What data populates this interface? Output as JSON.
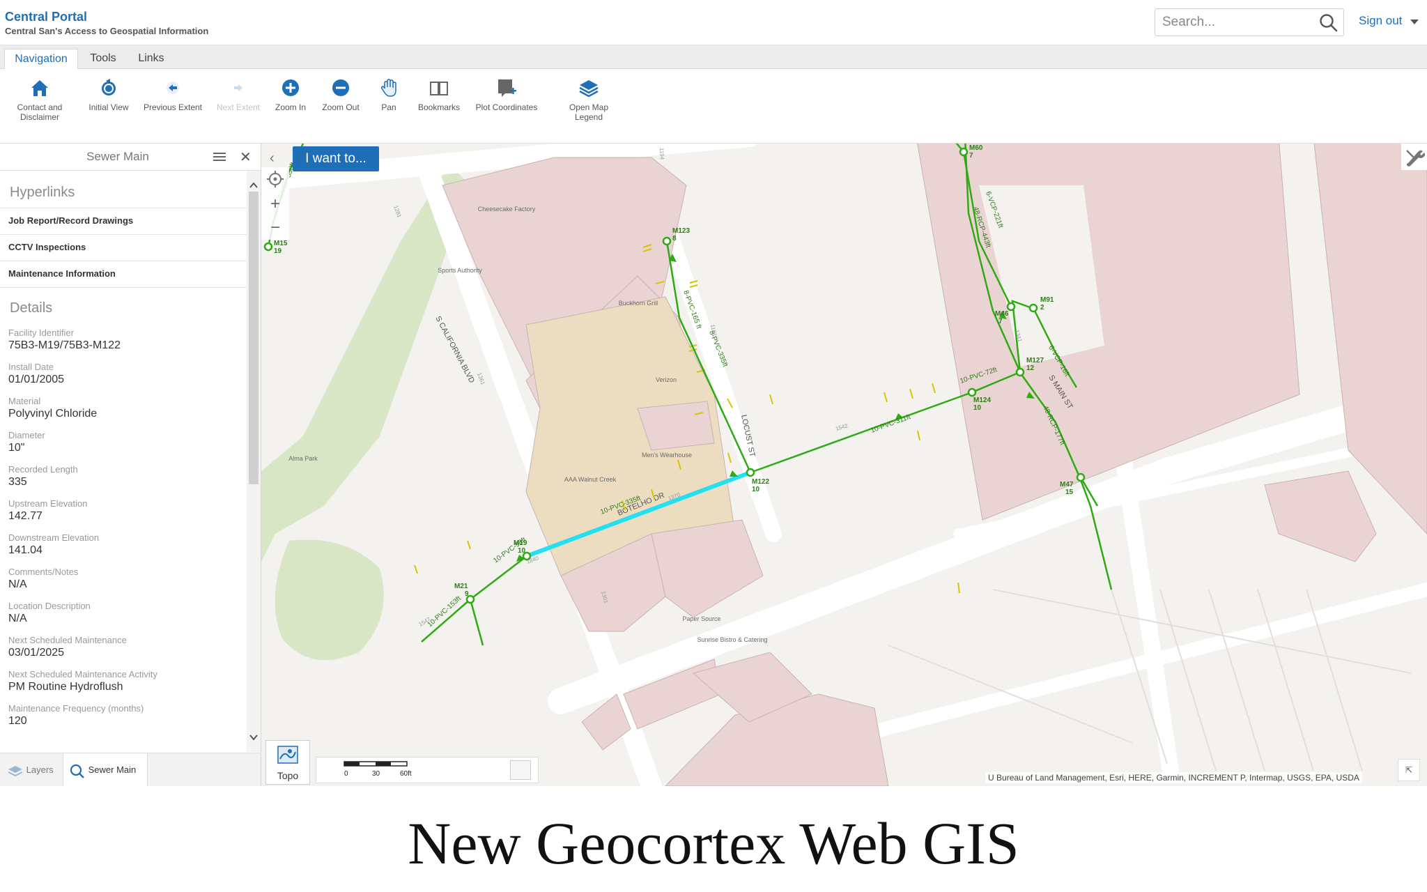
{
  "header": {
    "title": "Central Portal",
    "subtitle": "Central San's Access to Geospatial Information",
    "search_placeholder": "Search...",
    "signout_label": "Sign out"
  },
  "tabs": [
    {
      "label": "Navigation",
      "active": true
    },
    {
      "label": "Tools",
      "active": false
    },
    {
      "label": "Links",
      "active": false
    }
  ],
  "toolbar": {
    "contact_line1": "Contact and",
    "contact_line2": "Disclaimer",
    "initial_view": "Initial View",
    "previous_extent": "Previous Extent",
    "next_extent": "Next Extent",
    "zoom_in": "Zoom In",
    "zoom_out": "Zoom Out",
    "pan": "Pan",
    "bookmarks": "Bookmarks",
    "plot_coordinates": "Plot Coordinates",
    "legend_line1": "Open Map",
    "legend_line2": "Legend"
  },
  "panel": {
    "title": "Sewer Main",
    "hyperlinks_heading": "Hyperlinks",
    "hyperlinks": [
      "Job Report/Record Drawings",
      "CCTV Inspections",
      "Maintenance Information"
    ],
    "details_heading": "Details",
    "details": [
      {
        "label": "Facility Identifier",
        "value": "75B3-M19/75B3-M122"
      },
      {
        "label": "Install Date",
        "value": "01/01/2005"
      },
      {
        "label": "Material",
        "value": "Polyvinyl Chloride"
      },
      {
        "label": "Diameter",
        "value": "10\""
      },
      {
        "label": "Recorded Length",
        "value": "335"
      },
      {
        "label": "Upstream Elevation",
        "value": "142.77"
      },
      {
        "label": "Downstream Elevation",
        "value": "141.04"
      },
      {
        "label": "Comments/Notes",
        "value": "N/A"
      },
      {
        "label": "Location Description",
        "value": "N/A"
      },
      {
        "label": "Next Scheduled Maintenance",
        "value": "03/01/2025"
      },
      {
        "label": "Next Scheduled Maintenance Activity",
        "value": "PM Routine Hydroflush"
      },
      {
        "label": "Maintenance Frequency (months)",
        "value": "120"
      }
    ],
    "footer_layers": "Layers",
    "footer_sewer": "Sewer Main"
  },
  "map": {
    "want_label": "I want to...",
    "basemap_label": "Topo",
    "scale_ticks": [
      "0",
      "30",
      "60ft"
    ],
    "attribution": "Bureau of Land Management, Esri, HERE, Garmin, INCREMENT P, Intermap, USGS, EPA, USDA",
    "attribution_prefix": "U",
    "street_labels": [
      "S CALIFORNIA BLVD",
      "LOCUST ST",
      "BOTELHO DR",
      "S MAIN ST"
    ],
    "poi_labels": [
      "Cheesecake Factory",
      "Sports Authority",
      "Buckhorn Grill",
      "Verizon",
      "Men's Wearhouse",
      "AAA Walnut Creek",
      "Alma Park",
      "Paper Source",
      "Sunrise Bistro & Catering"
    ],
    "manholes": [
      {
        "id": "M15",
        "num": "19"
      },
      {
        "id": "M123",
        "num": "8"
      },
      {
        "id": "M60",
        "num": "7"
      },
      {
        "id": "M46",
        "num": "7"
      },
      {
        "id": "M91",
        "num": "2"
      },
      {
        "id": "M127",
        "num": "12"
      },
      {
        "id": "M124",
        "num": "10"
      },
      {
        "id": "M122",
        "num": "10"
      },
      {
        "id": "M19",
        "num": "10"
      },
      {
        "id": "M21",
        "num": "9"
      },
      {
        "id": "M47",
        "num": "15"
      }
    ],
    "pipe_labels": [
      "8-VCP-330ft",
      "8-PVC-165 ft",
      "8-PVC-335ft",
      "10-PVC-335ft",
      "10-PVC-98ft",
      "10-PVC-153ft",
      "10-PVC-311ft",
      "10-PVC-72ft",
      "6-VCP-221ft",
      "48-RCP-443ft",
      "6-VCP-16ft",
      "48-RCP-177ft"
    ],
    "address_labels": [
      "1800",
      "1194",
      "1281",
      "1361",
      "1151",
      "1542",
      "1370",
      "1840",
      "1301",
      "1547",
      "1341"
    ]
  },
  "colors": {
    "brand": "#1e6fb8",
    "pipe": "#2eaa12",
    "selected_pipe": "#22e0f0",
    "building": "#ead3d3",
    "park": "#d8e6c5",
    "road": "#ffffff"
  },
  "caption": "New Geocortex Web GIS"
}
